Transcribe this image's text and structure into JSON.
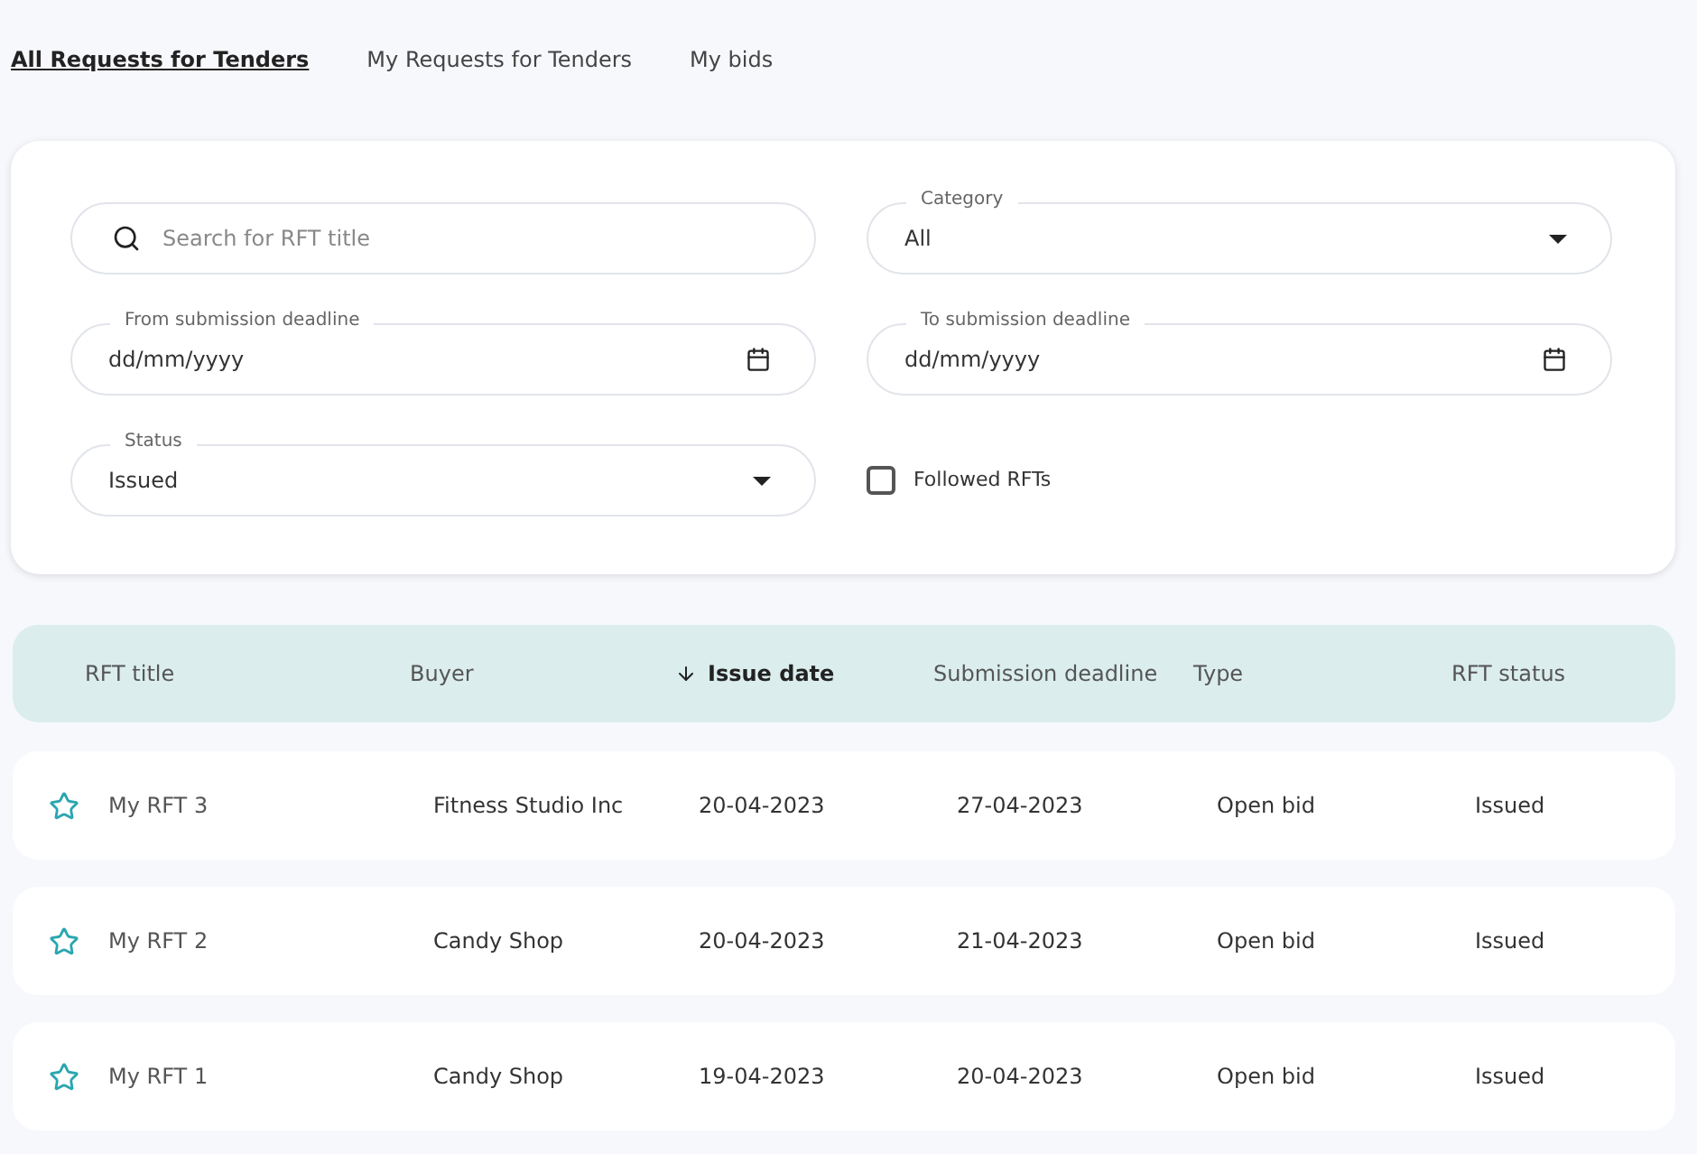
{
  "tabs": [
    {
      "label": "All Requests for Tenders",
      "selected": true
    },
    {
      "label": "My Requests for Tenders",
      "selected": false
    },
    {
      "label": "My bids",
      "selected": false
    }
  ],
  "filters": {
    "search": {
      "placeholder": "Search for RFT title"
    },
    "category": {
      "label": "Category",
      "value": "All"
    },
    "from_deadline": {
      "label": "From submission deadline",
      "value": "dd/mm/yyyy"
    },
    "to_deadline": {
      "label": "To submission deadline",
      "value": "dd/mm/yyyy"
    },
    "status": {
      "label": "Status",
      "value": "Issued"
    },
    "followed": {
      "label": "Followed RFTs",
      "checked": false
    }
  },
  "table": {
    "columns": [
      {
        "label": "RFT title",
        "sorted": false
      },
      {
        "label": "Buyer",
        "sorted": false
      },
      {
        "label": "Issue date",
        "sorted": true
      },
      {
        "label": "Submission deadline",
        "sorted": false
      },
      {
        "label": "Type",
        "sorted": false
      },
      {
        "label": "RFT status",
        "sorted": false
      }
    ],
    "rows": [
      {
        "followed": false,
        "cells": [
          "My RFT 3",
          "Fitness Studio Inc",
          "20-04-2023",
          "27-04-2023",
          "Open bid",
          "Issued"
        ]
      },
      {
        "followed": false,
        "cells": [
          "My RFT 2",
          "Candy Shop",
          "20-04-2023",
          "21-04-2023",
          "Open bid",
          "Issued"
        ]
      },
      {
        "followed": false,
        "cells": [
          "My RFT 1",
          "Candy Shop",
          "19-04-2023",
          "20-04-2023",
          "Open bid",
          "Issued"
        ]
      }
    ]
  }
}
